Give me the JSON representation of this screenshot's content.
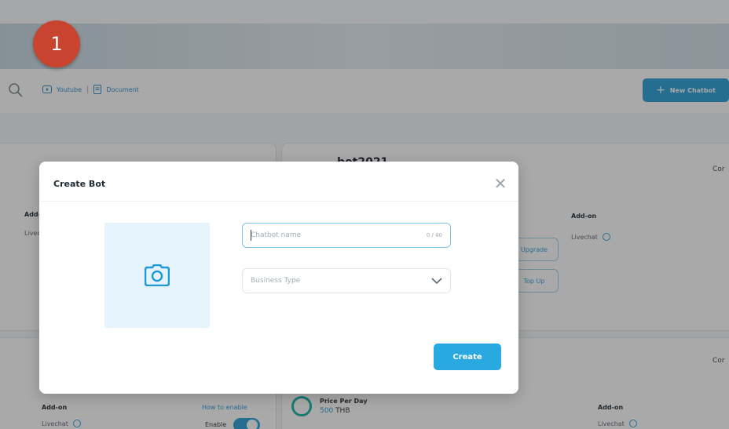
{
  "step_badge": "1",
  "header": {
    "youtube_label": "Youtube",
    "separator": "|",
    "document_label": "Document",
    "new_chatbot_label": "New Chatbot",
    "plus_glyph": "+"
  },
  "cards": {
    "partial_title": "bot2021",
    "upgrade_label": "Upgrade",
    "top_up_label": "Top Up",
    "addon_label": "Add-on",
    "livechat_label": "Livechat",
    "addon_label_2": "Add-on",
    "livechat_label_2": "Livechat",
    "addon_label_3": "Add-on",
    "livechat_label_3": "Livechat",
    "how_to_enable": "How to enable",
    "enable_label": "Enable",
    "price_per_day_label": "Price Per Day",
    "price_value": "500",
    "price_currency": "THB",
    "cor_1": "Cor",
    "cor_2": "Cor"
  },
  "modal": {
    "title": "Create Bot",
    "close_glyph": "✕",
    "name_placeholder": "Chatbot name",
    "name_counter": "0 / 40",
    "business_type_placeholder": "Business Type",
    "create_label": "Create"
  },
  "colors": {
    "accent": "#2aa9e0",
    "badge": "#c8442e"
  }
}
